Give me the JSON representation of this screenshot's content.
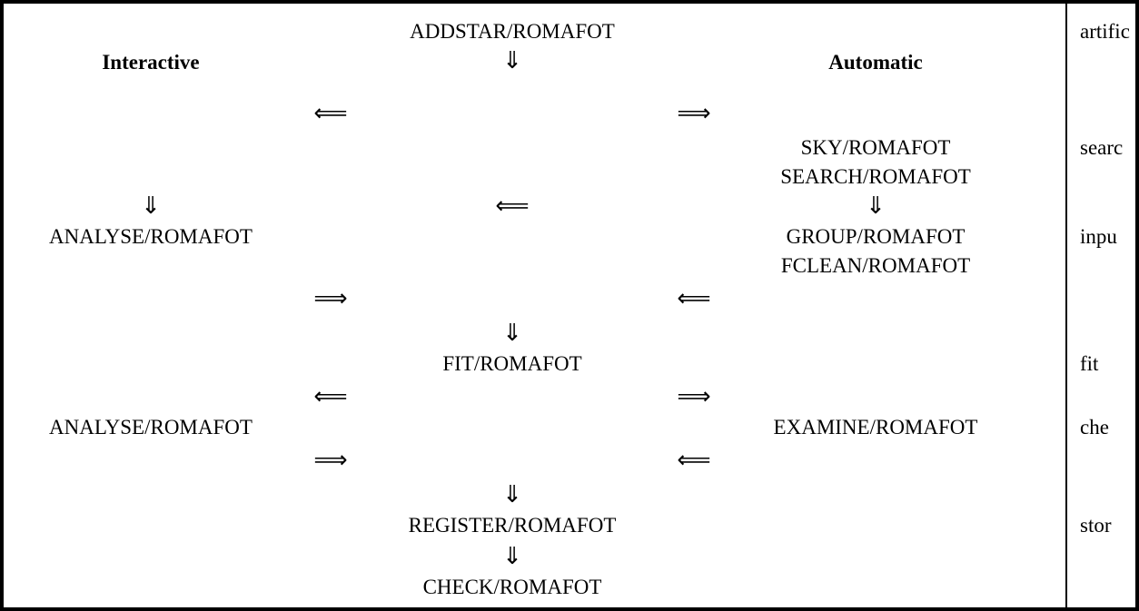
{
  "headers": {
    "interactive": "Interactive",
    "automatic": "Automatic"
  },
  "commands": {
    "addstar": "ADDSTAR/ROMAFOT",
    "sky": "SKY/ROMAFOT",
    "search": "SEARCH/ROMAFOT",
    "analyse": "ANALYSE/ROMAFOT",
    "group": "GROUP/ROMAFOT",
    "fclean": "FCLEAN/ROMAFOT",
    "fit": "FIT/ROMAFOT",
    "examine": "EXAMINE/ROMAFOT",
    "register": "REGISTER/ROMAFOT",
    "check": "CHECK/ROMAFOT"
  },
  "arrows": {
    "down": "⇓",
    "left": "⟸",
    "right": "⟹"
  },
  "side": {
    "artific": "artific",
    "searc": "searc",
    "inpu": "inpu",
    "fit": "fit",
    "che": "che",
    "stor": "stor"
  }
}
